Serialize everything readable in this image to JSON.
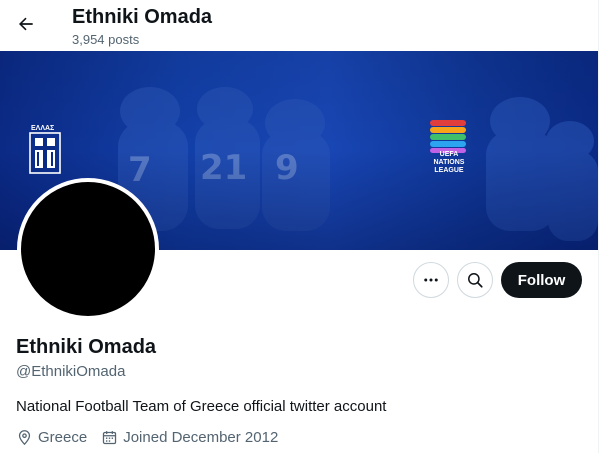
{
  "header": {
    "title": "Ethniki Omada",
    "post_count": "3,954 posts"
  },
  "banner": {
    "left_logo_text": "ΕΛΛΑΣ",
    "right_logo_text": "UEFA NATIONS LEAGUE",
    "accent_color": "#1846b4"
  },
  "profile": {
    "display_name": "Ethniki Omada",
    "handle": "@EthnikiOmada",
    "bio": "National Football Team of Greece official twitter account",
    "location": "Greece",
    "joined": "Joined December 2012"
  },
  "actions": {
    "follow_label": "Follow",
    "more_icon": "more-horizontal-icon",
    "search_icon": "search-icon"
  }
}
